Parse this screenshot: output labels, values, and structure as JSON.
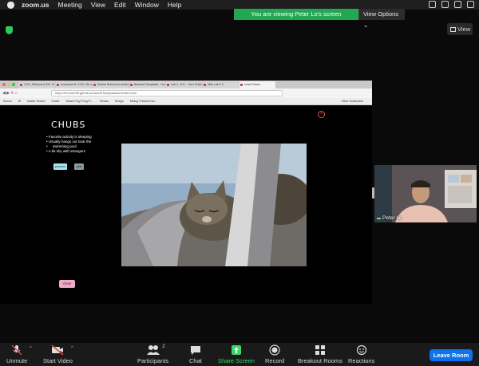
{
  "menubar": {
    "app": "zoom.us",
    "items": [
      "Meeting",
      "View",
      "Edit",
      "Window",
      "Help"
    ]
  },
  "share_banner": {
    "message": "You are viewing Peter Lo's screen",
    "options_label": "View Options"
  },
  "view_button": {
    "label": "View"
  },
  "browser": {
    "tabs": [
      "COG_DM3.pdf (COG 13 b)",
      "homework B: COG 13b s",
      "Denise Robinson's Assess",
      "Baseball Templates - Hom",
      "Lab 4 - KYL - User Testing",
      "Web Lab 2.0",
      "Undo Picture"
    ],
    "url": "https://hmoore99.github.io/davcl9 final/practice/index.html",
    "bookmarks": [
      "School",
      "W",
      "Insider Search",
      "Kinder",
      "Watch Ping Pong Pr...",
      "Fitness",
      "Design",
      "Mining Political Disc..."
    ],
    "other_bookmarks": "Other Bookmarks"
  },
  "page": {
    "title": "CHUBS",
    "bullets": [
      "Favorite activity is sleeping",
      "Usually hangs out near the",
      "swimming pool",
      "A bit shy with strangers"
    ],
    "previous_label": "previous",
    "next_label": "next",
    "close_label": "close"
  },
  "participant": {
    "name": "Peter Lo"
  },
  "toolbar": {
    "unmute": "Unmute",
    "start_video": "Start Video",
    "participants": "Participants",
    "participants_count": "2",
    "chat": "Chat",
    "share_screen": "Share Screen",
    "record": "Record",
    "breakout_rooms": "Breakout Rooms",
    "reactions": "Reactions",
    "leave_room": "Leave Room"
  },
  "colors": {
    "share_green": "#22a852",
    "leave_blue": "#0e72ed"
  }
}
